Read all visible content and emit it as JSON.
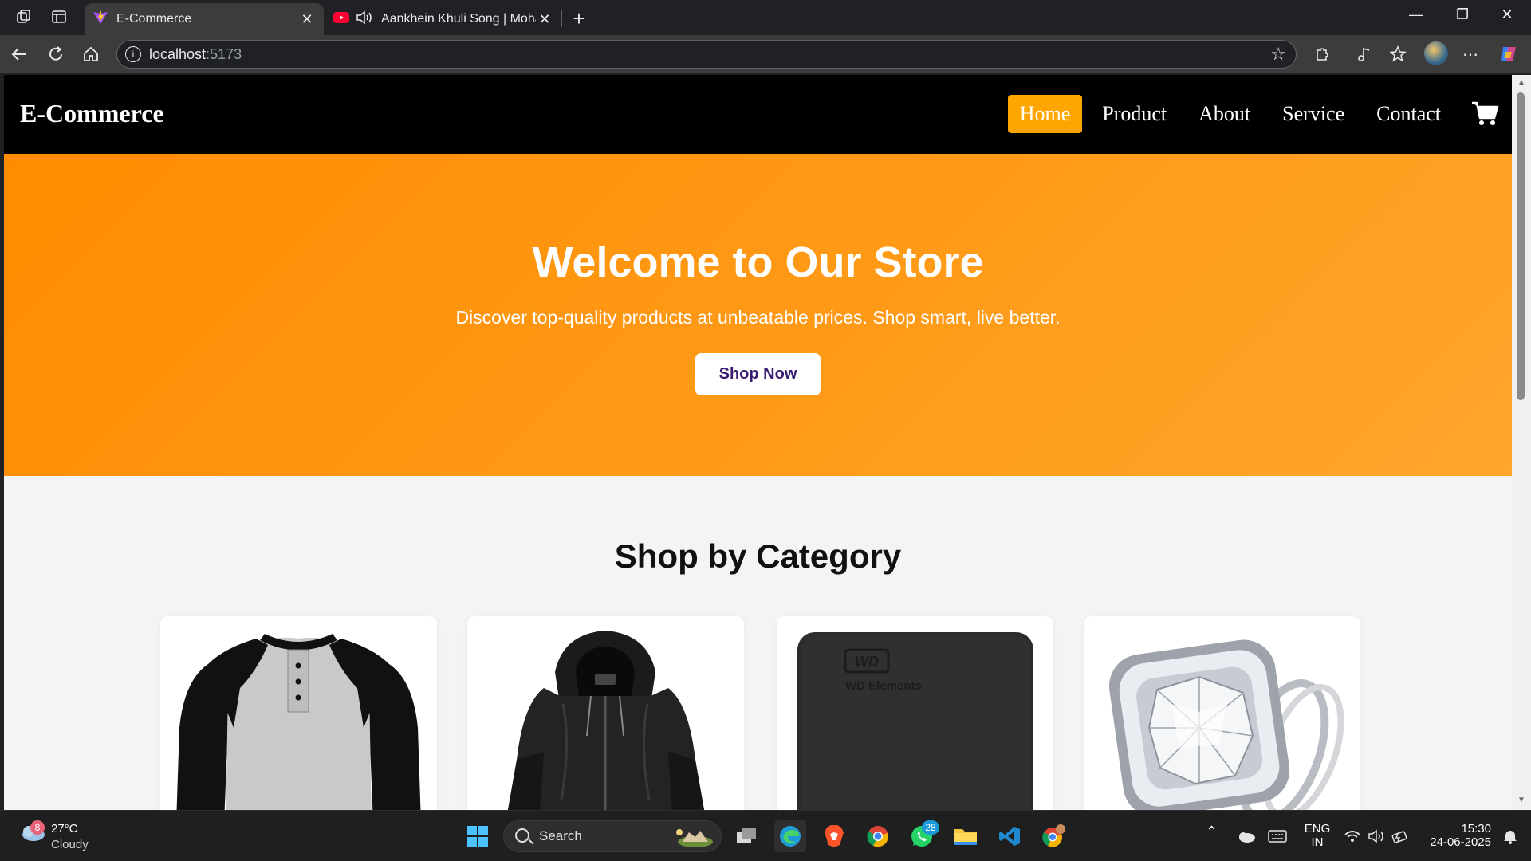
{
  "browser": {
    "tabs": [
      {
        "title": "E-Commerce",
        "active": true
      },
      {
        "title": "Aankhein Khuli Song | Moha",
        "active": false
      }
    ],
    "url_host": "localhost",
    "url_port": ":5173"
  },
  "site": {
    "brand": "E-Commerce",
    "nav": [
      {
        "label": "Home",
        "active": true
      },
      {
        "label": "Product",
        "active": false
      },
      {
        "label": "About",
        "active": false
      },
      {
        "label": "Service",
        "active": false
      },
      {
        "label": "Contact",
        "active": false
      }
    ],
    "hero": {
      "title": "Welcome to Our Store",
      "subtitle": "Discover top-quality products at unbeatable prices. Shop smart, live better.",
      "cta": "Shop Now"
    },
    "categories": {
      "title": "Shop by Category",
      "items": [
        {
          "image": "raglan-henley-shirt"
        },
        {
          "image": "black-leather-jacket"
        },
        {
          "image": "wd-elements-hard-drive"
        },
        {
          "image": "diamond-ring"
        }
      ],
      "drive_label": "WD Elements"
    },
    "colors": {
      "accent": "#ffa500",
      "hero_start": "#ff8c00",
      "hero_end": "#ffa62b",
      "cta_text": "#3a1c71"
    }
  },
  "taskbar": {
    "weather": {
      "temp": "27°C",
      "condition": "Cloudy",
      "badge": "8"
    },
    "search_label": "Search",
    "whatsapp_badge": "28",
    "lang": "ENG",
    "region": "IN",
    "time": "15:30",
    "date": "24-06-2025"
  }
}
